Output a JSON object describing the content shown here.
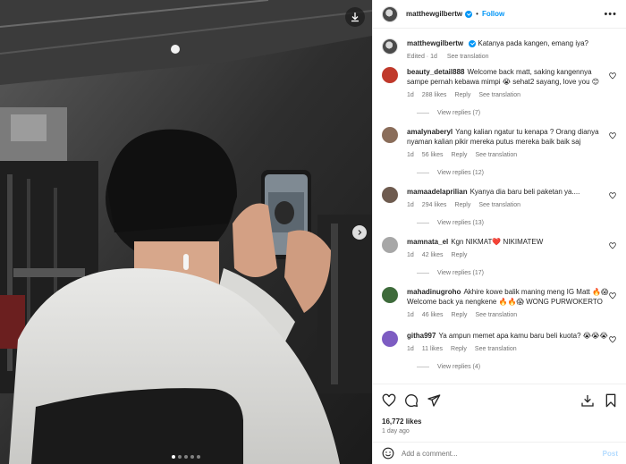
{
  "header": {
    "username": "matthewgilbertw",
    "separator": "•",
    "follow_label": "Follow",
    "more_label": "•••"
  },
  "caption": {
    "username": "matthewgilbertw",
    "text": "Katanya pada kangen, emang iya?",
    "edited": "Edited · 1d",
    "see_translation": "See translation"
  },
  "comments": [
    {
      "username": "beauty_detail888",
      "text": "Welcome back matt, saking kangennya sampe pernah kebawa mimpi 😭 sehat2 sayang, love you 😊",
      "time": "1d",
      "likes": "288 likes",
      "reply": "Reply",
      "translate": "See translation",
      "view_replies": "View replies (7)",
      "avatar_color": "#c0392b"
    },
    {
      "username": "amalynaberyl",
      "text": "Yang kalian ngatur tu kenapa ? Orang dianya nyaman kalian pikir mereka putus mereka baik baik saj",
      "time": "1d",
      "likes": "56 likes",
      "reply": "Reply",
      "translate": "See translation",
      "view_replies": "View replies (12)",
      "avatar_color": "#8a6d5a"
    },
    {
      "username": "mamaadelaprilian",
      "text": "Kyanya dia baru beli paketan ya....",
      "time": "1d",
      "likes": "294 likes",
      "reply": "Reply",
      "translate": "See translation",
      "view_replies": "View replies (13)",
      "avatar_color": "#6e5b4f"
    },
    {
      "username": "mamnata_el",
      "text": "Kgn NIKMAT❤️ NIKIMATEW",
      "time": "1d",
      "likes": "42 likes",
      "reply": "Reply",
      "translate": "",
      "view_replies": "View replies (17)",
      "avatar_color": "#a7a7a7"
    },
    {
      "username": "mahadinugroho",
      "text": "Akhire kowe balik maning meng IG Matt 🔥😱 Welcome back ya nengkene 🔥🔥😱 WONG PURWOKERTO",
      "time": "1d",
      "likes": "46 likes",
      "reply": "Reply",
      "translate": "See translation",
      "view_replies": "",
      "avatar_color": "#3e6b3b"
    },
    {
      "username": "githa997",
      "text": "Ya ampun memet apa kamu baru beli kuota? 😭😭😭",
      "time": "1d",
      "likes": "11 likes",
      "reply": "Reply",
      "translate": "See translation",
      "view_replies": "View replies (4)",
      "avatar_color": "#7d5cc2"
    }
  ],
  "stats": {
    "likes": "16,772 likes",
    "time_ago": "1 day ago"
  },
  "composer": {
    "placeholder": "Add a comment...",
    "post_label": "Post"
  },
  "carousel": {
    "slides": 5,
    "active_index": 0
  },
  "icons": [
    "download-icon",
    "chevron-right-icon",
    "more-icon",
    "heart-icon",
    "comment-icon",
    "share-icon",
    "save-icon",
    "bookmark-icon",
    "emoji-icon"
  ],
  "colors": {
    "accent": "#0095f6",
    "muted": "#737373",
    "border": "#efefef"
  }
}
